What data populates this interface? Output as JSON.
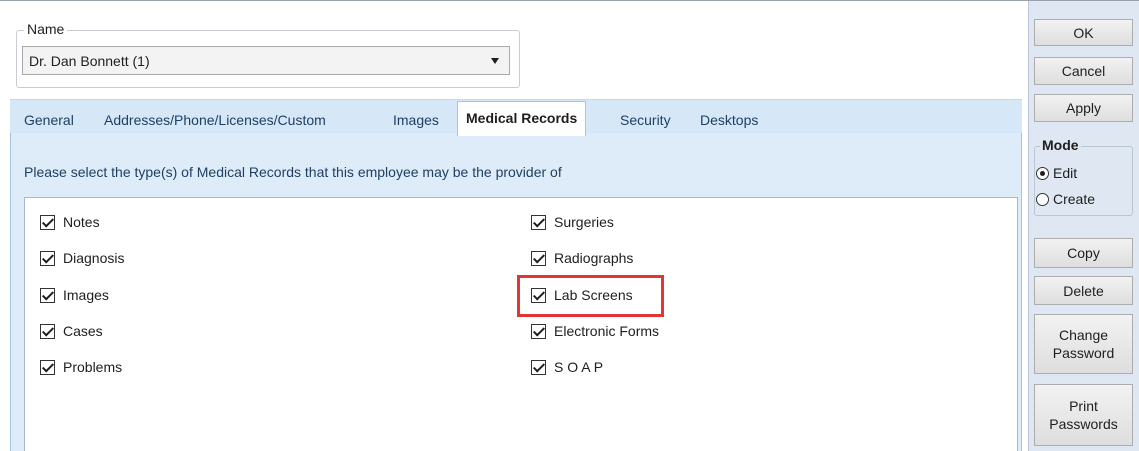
{
  "name_group": {
    "legend": "Name",
    "selected": "Dr. Dan Bonnett (1)"
  },
  "tabs": [
    {
      "label": "General",
      "active": false
    },
    {
      "label": "Addresses/Phone/Licenses/Custom",
      "active": false
    },
    {
      "label": "Images",
      "active": false
    },
    {
      "label": "Medical Records",
      "active": true
    },
    {
      "label": "Security",
      "active": false
    },
    {
      "label": "Desktops",
      "active": false
    }
  ],
  "medical_records": {
    "instructions": "Please select the type(s) of Medical Records that this employee may be the provider of",
    "left_items": [
      {
        "label": "Notes",
        "checked": true
      },
      {
        "label": "Diagnosis",
        "checked": true
      },
      {
        "label": "Images",
        "checked": true
      },
      {
        "label": "Cases",
        "checked": true
      },
      {
        "label": "Problems",
        "checked": true
      }
    ],
    "right_items": [
      {
        "label": "Surgeries",
        "checked": true
      },
      {
        "label": "Radiographs",
        "checked": true
      },
      {
        "label": "Lab Screens",
        "checked": true
      },
      {
        "label": "Electronic Forms",
        "checked": true
      },
      {
        "label": "S O A P",
        "checked": true
      }
    ],
    "highlight_color": "#e03636"
  },
  "actions": {
    "ok": "OK",
    "cancel": "Cancel",
    "apply": "Apply",
    "copy": "Copy",
    "delete": "Delete",
    "change_password": "Change Password",
    "print_passwords": "Print Passwords"
  },
  "mode": {
    "legend": "Mode",
    "options": [
      {
        "label": "Edit",
        "selected": true
      },
      {
        "label": "Create",
        "selected": false
      }
    ]
  }
}
